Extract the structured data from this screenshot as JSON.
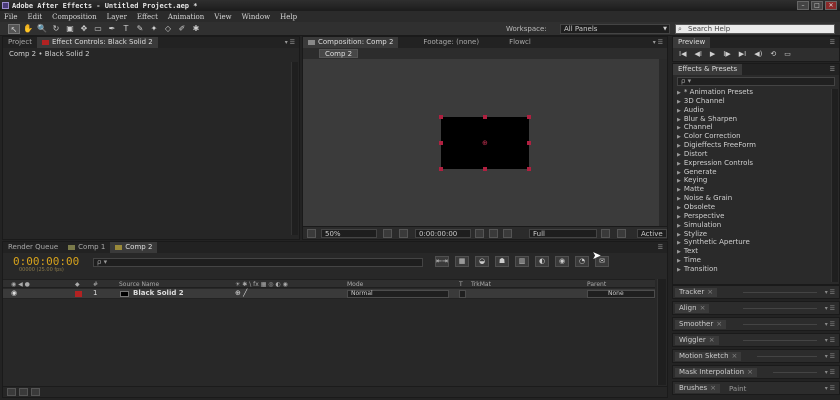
{
  "app": {
    "title": "Adobe After Effects - Untitled Project.aep *"
  },
  "menu": [
    "File",
    "Edit",
    "Composition",
    "Layer",
    "Effect",
    "Animation",
    "View",
    "Window",
    "Help"
  ],
  "toolbar": {
    "tools": [
      "selection-tool",
      "hand-tool",
      "zoom-tool",
      "rotation-tool",
      "camera-tool",
      "pan-behind-tool",
      "mask-tool",
      "pen-tool",
      "type-tool",
      "brush-tool",
      "clone-stamp-tool",
      "eraser-tool",
      "roto-brush-tool",
      "puppet-tool"
    ],
    "tool_glyphs": [
      "↖",
      "✋",
      "🔍",
      "↻",
      "▣",
      "✥",
      "▭",
      "✒",
      "T",
      "✎",
      "✦",
      "◇",
      "✐",
      "✱"
    ],
    "workspace_label": "Workspace:",
    "workspace_value": "All Panels",
    "search_help_placeholder": "Search Help"
  },
  "project_panel": {
    "tabs": [
      "Project",
      "Effect Controls: Black Solid 2"
    ],
    "path": "Comp 2 • Black Solid 2"
  },
  "comp_panel": {
    "tabs": [
      "Composition: Comp 2",
      "Footage: (none)",
      "Flowcl"
    ],
    "active_comp_chip": "Comp 2",
    "zoom": "50%",
    "timecode": "0:00:00:00",
    "resolution": "Full",
    "view_label": "Active"
  },
  "timeline": {
    "tabs": [
      "Render Queue",
      "Comp 1",
      "Comp 2"
    ],
    "timecode": "0:00:00:00",
    "fps": "00000 (25.00 fps)",
    "search_placeholder": "ρ ▾",
    "columns": {
      "num": "#",
      "source_name": "Source Name",
      "mode": "Mode",
      "t": "T",
      "trkmat": "TrkMat",
      "parent": "Parent"
    },
    "layers": [
      {
        "index": "1",
        "name": "Black Solid 2",
        "mode": "Normal",
        "parent": "None",
        "label_color": "#b22222"
      }
    ]
  },
  "preview": {
    "tab": "Preview",
    "controls": [
      "I◀",
      "◀I",
      "▶",
      "I▶",
      "▶I",
      "◀)",
      "⟲",
      "▭"
    ]
  },
  "effects_presets": {
    "tab": "Effects & Presets",
    "search_placeholder": "ρ ▾",
    "items": [
      "* Animation Presets",
      "3D Channel",
      "Audio",
      "Blur & Sharpen",
      "Channel",
      "Color Correction",
      "Digieffects FreeForm",
      "Distort",
      "Expression Controls",
      "Generate",
      "Keying",
      "Matte",
      "Noise & Grain",
      "Obsolete",
      "Perspective",
      "Simulation",
      "Stylize",
      "Synthetic Aperture",
      "Text",
      "Time",
      "Transition"
    ]
  },
  "mini_panels": [
    "Tracker",
    "Align",
    "Smoother",
    "Wiggler",
    "Motion Sketch",
    "Mask Interpolation"
  ],
  "bottom_tabs": [
    "Brushes",
    "Paint"
  ],
  "colors": {
    "timecode": "#d6a21c",
    "handle": "#b02040",
    "comp1_tab": "#7a7a4a",
    "comp2_tab": "#9a8a3a"
  }
}
